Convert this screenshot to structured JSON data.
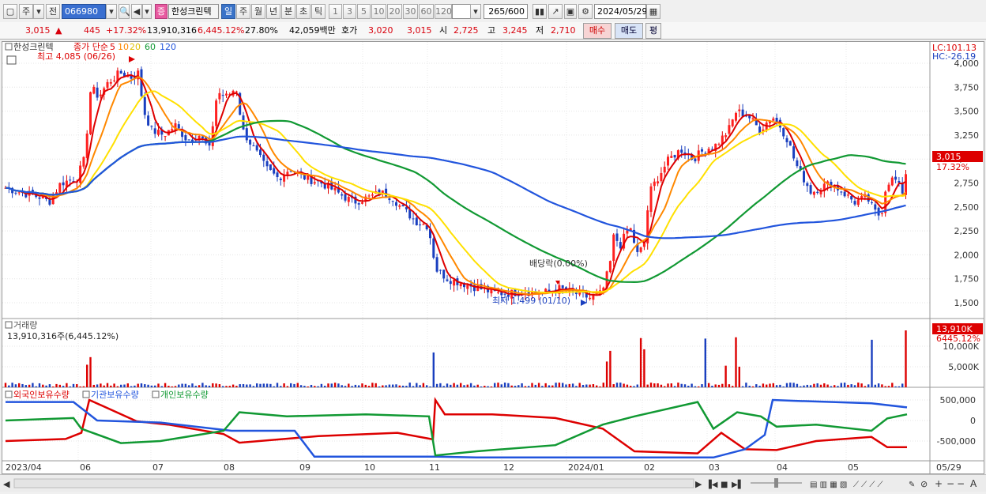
{
  "toolbar": {
    "freq_unit": "주",
    "prev_label": "전",
    "stock_code": "066980",
    "stock_badge": "증",
    "stock_name": "한성크린텍",
    "period_tabs": [
      "일",
      "주",
      "월",
      "년",
      "분",
      "초",
      "틱"
    ],
    "active_period": "일",
    "interval_buttons": [
      "1",
      "3",
      "5",
      "10",
      "20",
      "30",
      "60",
      "120"
    ],
    "count_value": "265",
    "count_max": "/600",
    "date_value": "2024/05/29"
  },
  "quote": {
    "price": "3,015",
    "change": "445",
    "change_pct": "+17.32%",
    "volume": "13,910,316",
    "volume_pct": "6,445.12%",
    "turnover": "27.80%",
    "amount": "42,059백만",
    "ask_label": "호가",
    "ask": "3,020",
    "bid": "3,015",
    "open_label": "시",
    "open": "2,725",
    "high_label": "고",
    "high": "3,245",
    "low_label": "저",
    "low": "2,710",
    "buy_button": "매수",
    "sell_button": "매도",
    "eval_button": "평"
  },
  "price_panel": {
    "legend_name": "한성크린텍",
    "legend_type": "종가 단순",
    "ma_periods": [
      "5",
      "10",
      "20",
      "60",
      "120"
    ],
    "ma_colors": [
      "#dd0000",
      "#ff8800",
      "#ffe000",
      "#119933",
      "#2255dd"
    ],
    "high_note": "최고 4,085 (06/26)",
    "low_note": "최저 1,499 (01/10)",
    "dividend_note": "배당락(0.00%)",
    "lc_label": "LC:101.13",
    "hc_label": "HC:-26.19",
    "current_price_tag": "3,015",
    "current_pct_tag": "17.32%",
    "y_ticks": [
      "4,000",
      "3,750",
      "3,500",
      "3,250",
      "3,000",
      "2,750",
      "2,500",
      "2,250",
      "2,000",
      "1,750",
      "1,500"
    ]
  },
  "volume_panel": {
    "title": "거래량",
    "value_text": "13,910,316주(6,445.12%)",
    "tag_value": "13,910K",
    "tag_pct": "6445.12%",
    "y_ticks": [
      "10,000K",
      "5,000K"
    ]
  },
  "holdings_panel": {
    "legends": [
      "외국인보유수량",
      "기관보유수량",
      "개인보유수량"
    ],
    "legend_colors": [
      "#dd0000",
      "#2255dd",
      "#119933"
    ],
    "y_ticks": [
      "500,000",
      "0",
      "-500,000"
    ]
  },
  "x_axis_labels": [
    "2023/04",
    "06",
    "07",
    "08",
    "09",
    "10",
    "11",
    "12",
    "2024/01",
    "02",
    "03",
    "04",
    "05"
  ],
  "x_axis_right": "05/29"
}
